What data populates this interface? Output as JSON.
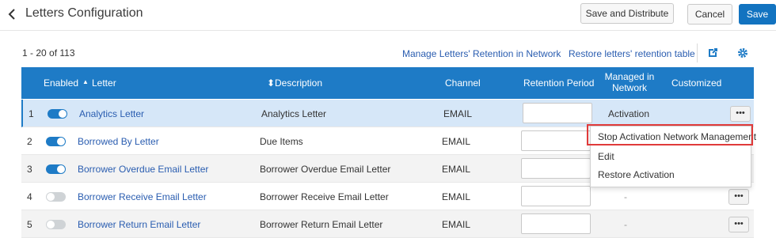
{
  "header": {
    "title": "Letters Configuration",
    "save_distribute_label": "Save and Distribute",
    "cancel_label": "Cancel",
    "save_label": "Save"
  },
  "toolbar": {
    "count": "1 - 20 of 113",
    "manage_link": "Manage Letters' Retention in Network",
    "restore_link": "Restore letters' retention table"
  },
  "table": {
    "columns": {
      "enabled": "Enabled",
      "letter": "Letter",
      "description": "Description",
      "channel": "Channel",
      "retention": "Retention Period",
      "managed_line1": "Managed in",
      "managed_line2": "Network",
      "customized": "Customized"
    },
    "rows": [
      {
        "num": "1",
        "enabled": true,
        "letter": "Analytics Letter",
        "description": "Analytics Letter",
        "channel": "EMAIL",
        "managed": "Activation"
      },
      {
        "num": "2",
        "enabled": true,
        "letter": "Borrowed By Letter",
        "description": "Due Items",
        "channel": "EMAIL",
        "managed": ""
      },
      {
        "num": "3",
        "enabled": true,
        "letter": "Borrower Overdue Email Letter",
        "description": "Borrower Overdue Email Letter",
        "channel": "EMAIL",
        "managed": ""
      },
      {
        "num": "4",
        "enabled": false,
        "letter": "Borrower Receive Email Letter",
        "description": "Borrower Receive Email Letter",
        "channel": "EMAIL",
        "managed": "-"
      },
      {
        "num": "5",
        "enabled": false,
        "letter": "Borrower Return Email Letter",
        "description": "Borrower Return Email Letter",
        "channel": "EMAIL",
        "managed": "-"
      }
    ],
    "more_label": "•••"
  },
  "menu": {
    "items": [
      "Stop Activation Network Management",
      "Edit",
      "Restore Activation"
    ]
  },
  "colors": {
    "header_bg": "#1e7bc6",
    "link": "#2a5db0",
    "highlight": "#e03a3a",
    "save_button": "#1273c0"
  }
}
